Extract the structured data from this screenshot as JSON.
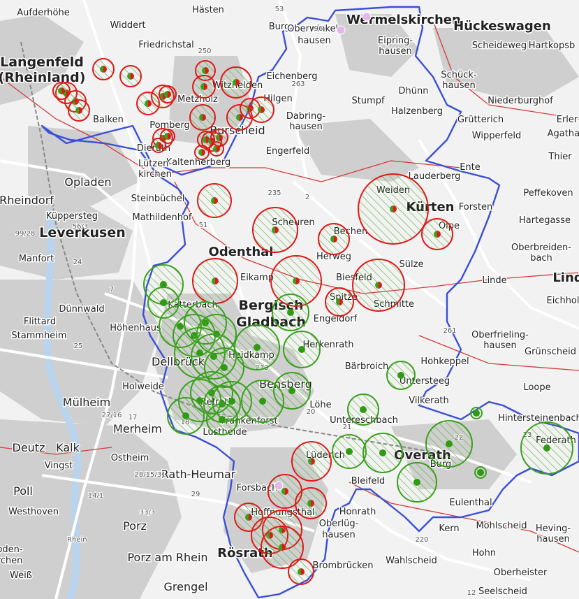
{
  "map": {
    "colors": {
      "background": "#f2f2f2",
      "settlement": "#c8c8c8",
      "district_border": "#3b4fd6",
      "admin_border": "#d43a3a",
      "red_marker": "#e01818",
      "green_marker": "#3aa01c",
      "road": "#ffffff",
      "river": "#b8d4ee"
    },
    "places": [
      {
        "name": "Aufderhöhe",
        "size": "s"
      },
      {
        "name": "Widdert",
        "size": "s"
      },
      {
        "name": "Hästen",
        "size": "s"
      },
      {
        "name": "Burg",
        "size": "s"
      },
      {
        "name": "Wermelskirchen",
        "size": "l"
      },
      {
        "name": "Hückeswagen",
        "size": "l"
      },
      {
        "name": "Langenfeld",
        "size": "xl"
      },
      {
        "name": "(Rheinland)",
        "size": "xl"
      },
      {
        "name": "Friedrichstal",
        "size": "s"
      },
      {
        "name": "Oberwinkel-",
        "size": "s"
      },
      {
        "name": "hausen",
        "size": "s"
      },
      {
        "name": "Eipring-",
        "size": "s"
      },
      {
        "name": "hausen",
        "size": "s"
      },
      {
        "name": "Scheideweg",
        "size": "s"
      },
      {
        "name": "Hartkopsb",
        "size": "s"
      },
      {
        "name": "Schück-",
        "size": "s"
      },
      {
        "name": "hausen",
        "size": "s"
      },
      {
        "name": "Eichenberg",
        "size": "s"
      },
      {
        "name": "Witzhelden",
        "size": "s"
      },
      {
        "name": "Hilgen",
        "size": "s"
      },
      {
        "name": "Stumpf",
        "size": "s"
      },
      {
        "name": "Dhünn",
        "size": "s"
      },
      {
        "name": "Niederburghof",
        "size": "s"
      },
      {
        "name": "Metzholz",
        "size": "s"
      },
      {
        "name": "Dabring-",
        "size": "s"
      },
      {
        "name": "hausen",
        "size": "s"
      },
      {
        "name": "Halzenberg",
        "size": "s"
      },
      {
        "name": "Grütterich",
        "size": "s"
      },
      {
        "name": "Erler",
        "size": "s"
      },
      {
        "name": "Agathabe",
        "size": "s"
      },
      {
        "name": "Balken",
        "size": "s"
      },
      {
        "name": "Pomberg",
        "size": "s"
      },
      {
        "name": "Burscheid",
        "size": "m"
      },
      {
        "name": "Wipperfeld",
        "size": "s"
      },
      {
        "name": "Dierath",
        "size": "s"
      },
      {
        "name": "Engerfeld",
        "size": "s"
      },
      {
        "name": "Thier",
        "size": "s"
      },
      {
        "name": "Kaltenherberg",
        "size": "s"
      },
      {
        "name": "Lützen-",
        "size": "s"
      },
      {
        "name": "kirchen",
        "size": "s"
      },
      {
        "name": "Ente",
        "size": "s"
      },
      {
        "name": "Opladen",
        "size": "m"
      },
      {
        "name": "Lauderberg",
        "size": "s"
      },
      {
        "name": "Weiden",
        "size": "s"
      },
      {
        "name": "Peffekoven",
        "size": "s"
      },
      {
        "name": "Rheindorf",
        "size": "m"
      },
      {
        "name": "Steinbüchel",
        "size": "s"
      },
      {
        "name": "Kürten",
        "size": "l"
      },
      {
        "name": "Forsten",
        "size": "s"
      },
      {
        "name": "Küppersteg",
        "size": "s"
      },
      {
        "name": "Scheuren",
        "size": "s"
      },
      {
        "name": "Olpe",
        "size": "s"
      },
      {
        "name": "Hartegasse",
        "size": "s"
      },
      {
        "name": "Leverkusen",
        "size": "xl"
      },
      {
        "name": "Mathildenhof",
        "size": "s"
      },
      {
        "name": "Bechen",
        "size": "s"
      },
      {
        "name": "Oberbreiden-",
        "size": "s"
      },
      {
        "name": "bach",
        "size": "s"
      },
      {
        "name": "Manfort",
        "size": "s"
      },
      {
        "name": "Odenthal",
        "size": "l"
      },
      {
        "name": "Herweg",
        "size": "s"
      },
      {
        "name": "Sülze",
        "size": "s"
      },
      {
        "name": "Eikamp",
        "size": "s"
      },
      {
        "name": "Biesfeld",
        "size": "s"
      },
      {
        "name": "Linde",
        "size": "s"
      },
      {
        "name": "Lind",
        "size": "l"
      },
      {
        "name": "Katterbach",
        "size": "s"
      },
      {
        "name": "Spitze",
        "size": "s"
      },
      {
        "name": "Schmitte",
        "size": "s"
      },
      {
        "name": "Eichhol",
        "size": "s"
      },
      {
        "name": "Dünnwald",
        "size": "s"
      },
      {
        "name": "Bergisch",
        "size": "xl"
      },
      {
        "name": "Gladbach",
        "size": "xl"
      },
      {
        "name": "Flittard",
        "size": "s"
      },
      {
        "name": "Höhenhaus",
        "size": "s"
      },
      {
        "name": "Engeldorf",
        "size": "s"
      },
      {
        "name": "Stammheim",
        "size": "s"
      },
      {
        "name": "Herkenrath",
        "size": "s"
      },
      {
        "name": "Oberfrieling-",
        "size": "s"
      },
      {
        "name": "hausen",
        "size": "s"
      },
      {
        "name": "Heidkamp",
        "size": "s"
      },
      {
        "name": "Grünscheid",
        "size": "s"
      },
      {
        "name": "Dellbrück",
        "size": "m"
      },
      {
        "name": "Hohkeppel",
        "size": "s"
      },
      {
        "name": "Bärbroich",
        "size": "s"
      },
      {
        "name": "Holweide",
        "size": "s"
      },
      {
        "name": "Bensberg",
        "size": "m"
      },
      {
        "name": "Untersteeg",
        "size": "s"
      },
      {
        "name": "Loope",
        "size": "s"
      },
      {
        "name": "Mülheim",
        "size": "m"
      },
      {
        "name": "Vilkerath",
        "size": "s"
      },
      {
        "name": "Refrath",
        "size": "s"
      },
      {
        "name": "Löhe",
        "size": "s"
      },
      {
        "name": "Frankenforst",
        "size": "s"
      },
      {
        "name": "Untereschbach",
        "size": "s"
      },
      {
        "name": "Hintersteinenbach",
        "size": "s"
      },
      {
        "name": "Merheim",
        "size": "m"
      },
      {
        "name": "Lustheide",
        "size": "s"
      },
      {
        "name": "Federath",
        "size": "s"
      },
      {
        "name": "Deutz",
        "size": "m"
      },
      {
        "name": "Kalk",
        "size": "m"
      },
      {
        "name": "Overath",
        "size": "l"
      },
      {
        "name": "Vingst",
        "size": "s"
      },
      {
        "name": "Ostheim",
        "size": "s"
      },
      {
        "name": "Lüderich",
        "size": "s"
      },
      {
        "name": "Burg",
        "size": "s"
      },
      {
        "name": "Rath-Heumar",
        "size": "m"
      },
      {
        "name": "Forsbach",
        "size": "s"
      },
      {
        "name": "Bleifeld",
        "size": "s"
      },
      {
        "name": "Poll",
        "size": "m"
      },
      {
        "name": "Eulenthal",
        "size": "s"
      },
      {
        "name": "Westhoven",
        "size": "s"
      },
      {
        "name": "Honrath",
        "size": "s"
      },
      {
        "name": "Hoffnungsthal",
        "size": "s"
      },
      {
        "name": "Oberlüg-",
        "size": "s"
      },
      {
        "name": "hausen",
        "size": "s"
      },
      {
        "name": "Mohlscheid",
        "size": "s"
      },
      {
        "name": "Heving-",
        "size": "s"
      },
      {
        "name": "hausen",
        "size": "s"
      },
      {
        "name": "Porz",
        "size": "m"
      },
      {
        "name": "Kern",
        "size": "s"
      },
      {
        "name": "oden-",
        "size": "s"
      },
      {
        "name": "rchen",
        "size": "s"
      },
      {
        "name": "Rösrath",
        "size": "l"
      },
      {
        "name": "Hohn",
        "size": "s"
      },
      {
        "name": "Porz am Rhein",
        "size": "m"
      },
      {
        "name": "Wahlscheid",
        "size": "s"
      },
      {
        "name": "Weiß",
        "size": "s"
      },
      {
        "name": "Brombrücken",
        "size": "s"
      },
      {
        "name": "Oberheister",
        "size": "s"
      },
      {
        "name": "Grengel",
        "size": "m"
      },
      {
        "name": "Seelscheid",
        "size": "s"
      }
    ],
    "road_numbers": [
      "53",
      "96",
      "250",
      "263",
      "235",
      "2",
      "51",
      "99/28",
      "56/3",
      "24",
      "7",
      "25",
      "213",
      "261",
      "21",
      "20",
      "27/16",
      "17",
      "18",
      "22",
      "23",
      "28/15/31",
      "29",
      "14/1",
      "33/3",
      "220",
      "12"
    ],
    "river": {
      "name": "Rhein"
    }
  }
}
